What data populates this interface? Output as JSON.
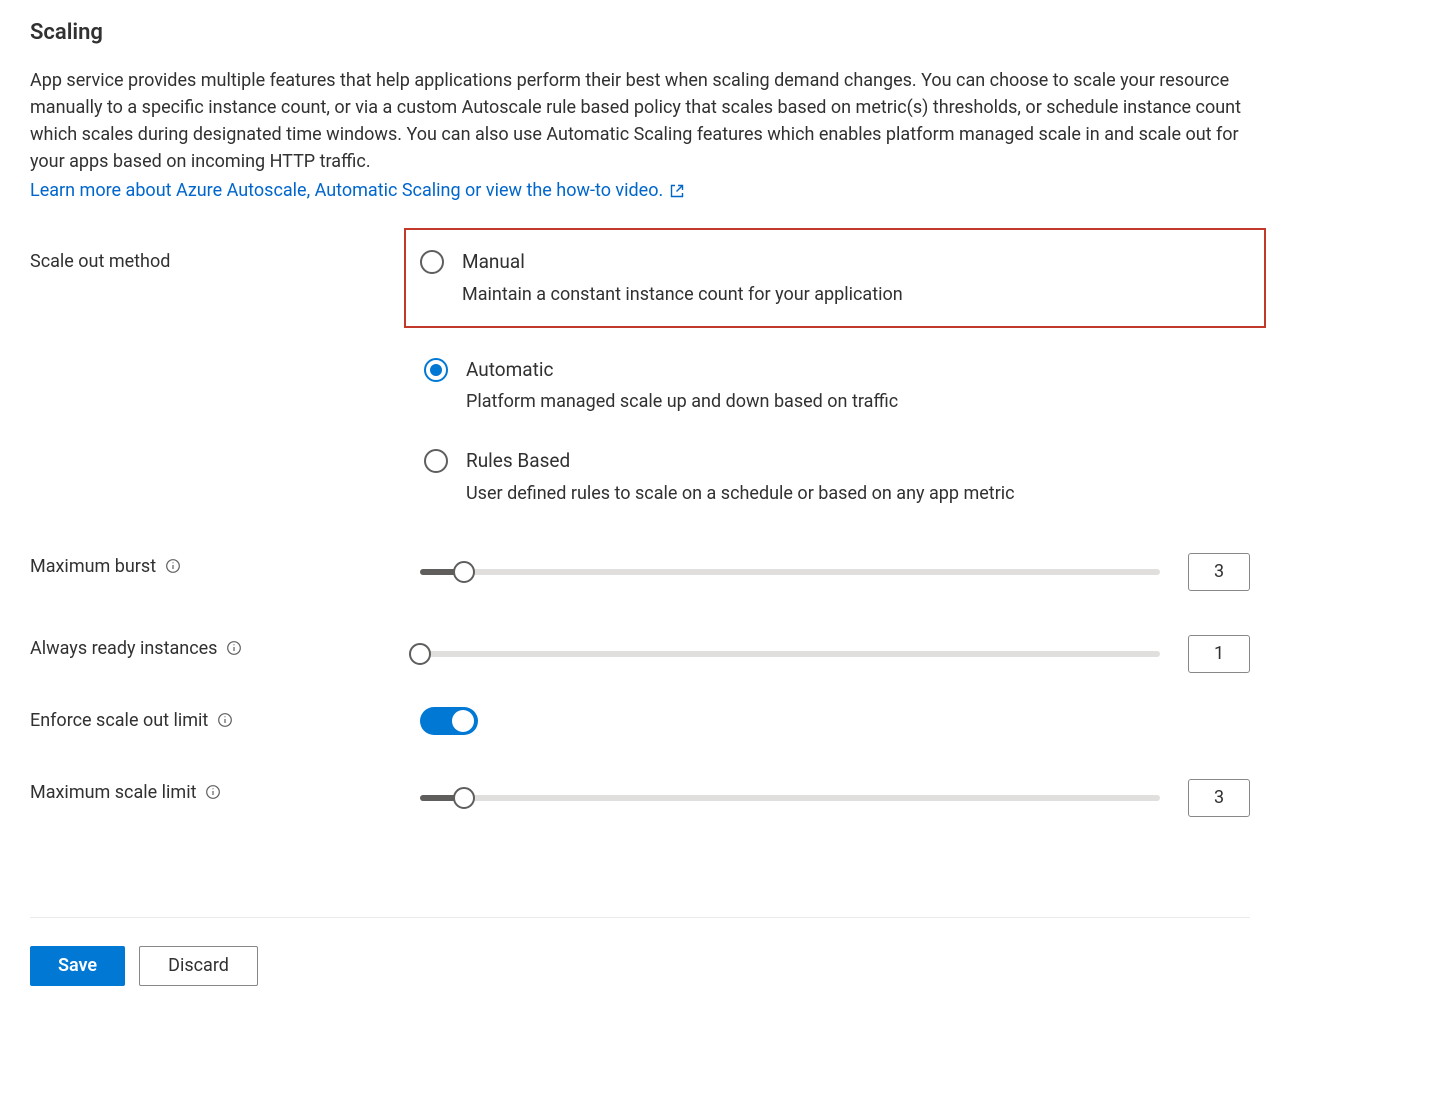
{
  "title": "Scaling",
  "intro": "App service provides multiple features that help applications perform their best when scaling demand changes. You can choose to scale your resource manually to a specific instance count, or via a custom Autoscale rule based policy that scales based on metric(s) thresholds, or schedule instance count which scales during designated time windows. You can also use Automatic Scaling features which enables platform managed scale in and scale out for your apps based on incoming HTTP traffic.",
  "learn_more_label": "Learn more about Azure Autoscale, Automatic Scaling or view the how-to video.",
  "scale_out_method": {
    "label": "Scale out method",
    "selected": "automatic",
    "options": {
      "manual": {
        "title": "Manual",
        "desc": "Maintain a constant instance count for your application"
      },
      "automatic": {
        "title": "Automatic",
        "desc": "Platform managed scale up and down based on traffic"
      },
      "rules": {
        "title": "Rules Based",
        "desc": "User defined rules to scale on a schedule or based on any app metric"
      }
    }
  },
  "settings": {
    "maximum_burst": {
      "label": "Maximum burst",
      "value": "3",
      "slider_pct": 6
    },
    "always_ready": {
      "label": "Always ready instances",
      "value": "1",
      "slider_pct": 0
    },
    "enforce_limit": {
      "label": "Enforce scale out limit",
      "value": true
    },
    "max_scale_limit": {
      "label": "Maximum scale limit",
      "value": "3",
      "slider_pct": 6
    }
  },
  "buttons": {
    "save": "Save",
    "discard": "Discard"
  }
}
